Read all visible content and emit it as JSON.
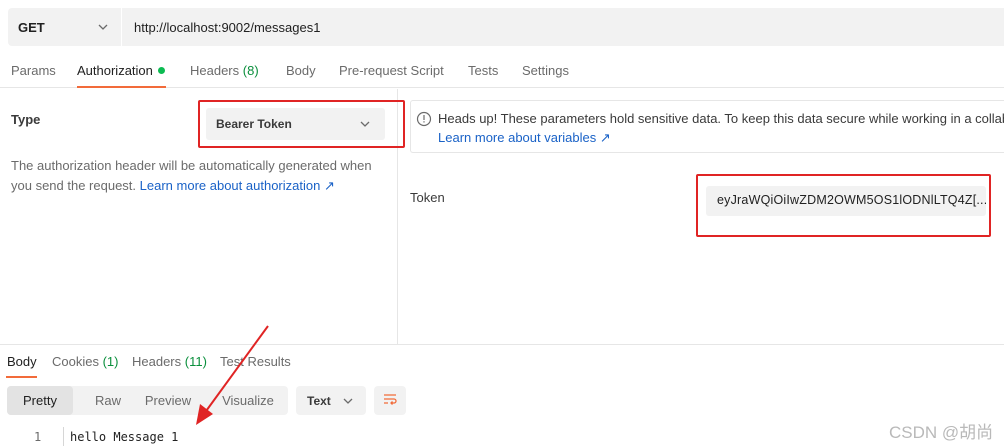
{
  "request": {
    "method": "GET",
    "url": "http://localhost:9002/messages1"
  },
  "request_tabs": {
    "params": "Params",
    "authorization": "Authorization",
    "headers": "Headers",
    "headers_count": "(8)",
    "body": "Body",
    "pre_request": "Pre-request Script",
    "tests": "Tests",
    "settings": "Settings"
  },
  "auth": {
    "type_label": "Type",
    "type_value": "Bearer Token",
    "description": "The authorization header will be automatically generated when you send the request.",
    "description_link": "Learn more about authorization ↗",
    "notice_text": "Heads up! These parameters hold sensitive data. To keep this data secure while working in a collabo",
    "notice_link": "Learn more about variables ↗",
    "token_label": "Token",
    "token_value": "eyJraWQiOiIwZDM2OWM5OS1lODNlLTQ4Z[..."
  },
  "response_tabs": {
    "body": "Body",
    "cookies": "Cookies",
    "cookies_count": "(1)",
    "headers": "Headers",
    "headers_count": "(11)",
    "test_results": "Test Results"
  },
  "response_view": {
    "modes": [
      "Pretty",
      "Raw",
      "Preview",
      "Visualize"
    ],
    "format": "Text",
    "line_number": "1",
    "code_line": "hello Message 1"
  },
  "watermark": "CSDN @胡尚",
  "icons": {
    "method_dropdown": "chevron-down-icon",
    "type_dropdown": "chevron-down-icon",
    "info": "info-circle-icon",
    "format_dropdown": "chevron-down-icon",
    "wrap": "wrap-lines-icon"
  },
  "colors": {
    "accent_tab": "#f26b3a",
    "status_dot": "#0cbb52",
    "link": "#1a62c7",
    "annotation": "#e02424",
    "count": "#0a8f3c"
  }
}
